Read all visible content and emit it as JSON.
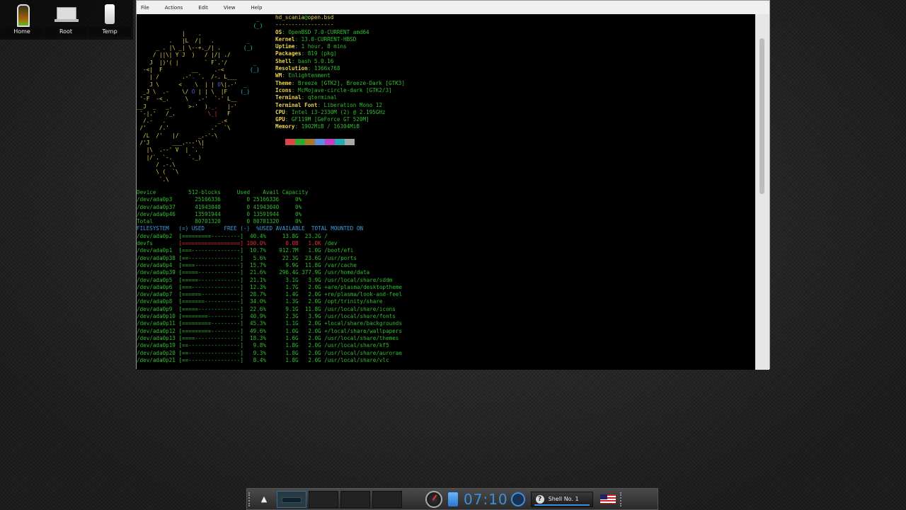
{
  "desktop_icons": [
    {
      "label": "Home",
      "icon": "home-folder-icon"
    },
    {
      "label": "Root",
      "icon": "laptop-icon"
    },
    {
      "label": "Temp",
      "icon": "temp-box-icon"
    }
  ],
  "window": {
    "menu": [
      "File",
      "Actions",
      "Edit",
      "View",
      "Help"
    ]
  },
  "neofetch": {
    "user": "hd_scania",
    "at": "@",
    "host": "open.bsd",
    "separator": "------------------",
    "fields": [
      {
        "key": "OS",
        "value": "OpenBSD 7.0-CURRENT amd64"
      },
      {
        "key": "Kernel",
        "value": "13.0-CURRENT-HBSD"
      },
      {
        "key": "Uptime",
        "value": "1 hour, 8 mins"
      },
      {
        "key": "Packages",
        "value": "819 (pkg)"
      },
      {
        "key": "Shell",
        "value": "bash 5.0.16"
      },
      {
        "key": "Resolution",
        "value": "1366x768"
      },
      {
        "key": "WM",
        "value": "Enlightenment"
      },
      {
        "key": "Theme",
        "value": "Breeze [GTK2], Breeze-Dark [GTK3]"
      },
      {
        "key": "Icons",
        "value": "McMojave-circle-dark [GTK2/3]"
      },
      {
        "key": "Terminal",
        "value": "qterminal"
      },
      {
        "key": "Terminal Font",
        "value": "Liberation Mono 12"
      },
      {
        "key": "CPU",
        "value": "Intel i3-2330M (2) @ 2.195GHz"
      },
      {
        "key": "GPU",
        "value": "GF119M [GeForce GT 520M]"
      },
      {
        "key": "Memory",
        "value": "1902MiB / 16304MiB"
      }
    ],
    "swatches": [
      "#d94848",
      "#2fa82f",
      "#a8782a",
      "#5a8ee0",
      "#c040c0",
      "#28a8b0",
      "#a8a8a8"
    ]
  },
  "swap_table": {
    "header": "Device          512-blocks     Used    Avail Capacity",
    "rows": [
      "/dev/ada0p3       25166336        0 25166336     0%",
      "/dev/ada0p37      41943040        0 41943040     0%",
      "/dev/ada0p46      13591944        0 13591944     0%",
      "Total             80701320        0 80701320     0%"
    ]
  },
  "fs_table": {
    "header": "FILESYSTEM   (=) USED      FREE (-)  %USED AVAILABLE  TOTAL MOUNTED ON",
    "rows": [
      {
        "fs": "/dev/ada0p2 ",
        "bar": "[=========---------]",
        "used": "  40.4%",
        "avail": "     13.8G",
        "total": "  23.2G",
        "mount": " /",
        "alert": false
      },
      {
        "fs": "devfs       ",
        "bar": "[==================]",
        "used": " 100.0%",
        "avail": "      0.0B",
        "total": "   1.0K",
        "mount": " /dev",
        "alert": true
      },
      {
        "fs": "/dev/ada0p1 ",
        "bar": "[===---------------]",
        "used": "  10.7%",
        "avail": "    912.7M",
        "total": "   1.0G",
        "mount": " /boot/efi",
        "alert": false
      },
      {
        "fs": "/dev/ada0p38",
        "bar": "[==----------------]",
        "used": "   5.6%",
        "avail": "     22.3G",
        "total": "  23.6G",
        "mount": " /usr/ports",
        "alert": false
      },
      {
        "fs": "/dev/ada0p4 ",
        "bar": "[====--------------]",
        "used": "  15.7%",
        "avail": "      9.9G",
        "total": "  11.8G",
        "mount": " /var/cache",
        "alert": false
      },
      {
        "fs": "/dev/ada0p39",
        "bar": "[=====-------------]",
        "used": "  21.6%",
        "avail": "    296.4G",
        "total": " 377.9G",
        "mount": " /usr/home/data",
        "alert": false
      },
      {
        "fs": "/dev/ada0p5 ",
        "bar": "[=====-------------]",
        "used": "  21.1%",
        "avail": "      3.1G",
        "total": "   3.9G",
        "mount": " /usr/local/share/sddm",
        "alert": false
      },
      {
        "fs": "/dev/ada0p6 ",
        "bar": "[===---------------]",
        "used": "  12.3%",
        "avail": "      1.7G",
        "total": "   2.0G",
        "mount": " +are/plasma/desktoptheme",
        "alert": false
      },
      {
        "fs": "/dev/ada0p7 ",
        "bar": "[======------------]",
        "used": "  28.7%",
        "avail": "      1.4G",
        "total": "   2.0G",
        "mount": " +re/plasma/look-and-feel",
        "alert": false
      },
      {
        "fs": "/dev/ada0p8 ",
        "bar": "[=======-----------]",
        "used": "  34.0%",
        "avail": "      1.3G",
        "total": "   2.0G",
        "mount": " /opt/trinity/share",
        "alert": false
      },
      {
        "fs": "/dev/ada0p9 ",
        "bar": "[=====-------------]",
        "used": "  22.6%",
        "avail": "      9.1G",
        "total": "  11.8G",
        "mount": " /usr/local/share/icons",
        "alert": false
      },
      {
        "fs": "/dev/ada0p10",
        "bar": "[========----------]",
        "used": "  40.9%",
        "avail": "      2.3G",
        "total": "   3.9G",
        "mount": " /usr/local/share/fonts",
        "alert": false
      },
      {
        "fs": "/dev/ada0p11",
        "bar": "[=========---------]",
        "used": "  45.3%",
        "avail": "      1.1G",
        "total": "   2.0G",
        "mount": " +local/share/backgrounds",
        "alert": false
      },
      {
        "fs": "/dev/ada0p12",
        "bar": "[=========---------]",
        "used": "  49.6%",
        "avail": "      1.0G",
        "total": "   2.0G",
        "mount": " +/local/share/wallpapers",
        "alert": false
      },
      {
        "fs": "/dev/ada0p13",
        "bar": "[====--------------]",
        "used": "  18.3%",
        "avail": "      1.6G",
        "total": "   2.0G",
        "mount": " /usr/local/share/themes",
        "alert": false
      },
      {
        "fs": "/dev/ada0p19",
        "bar": "[==----------------]",
        "used": "   9.8%",
        "avail": "      1.8G",
        "total": "   2.0G",
        "mount": " /usr/local/share/kf5",
        "alert": false
      },
      {
        "fs": "/dev/ada0p20",
        "bar": "[==----------------]",
        "used": "   9.3%",
        "avail": "      1.8G",
        "total": "   2.0G",
        "mount": " /usr/local/share/aurorae",
        "alert": false
      },
      {
        "fs": "/dev/ada0p21",
        "bar": "[==----------------]",
        "used": "   8.4%",
        "avail": "      1.8G",
        "total": "   2.0G",
        "mount": " /usr/local/share/vlc",
        "alert": false
      }
    ]
  },
  "taskbar": {
    "clock": "07:10",
    "task_label": "Shell No. 1",
    "task_icon_glyph": "?"
  }
}
